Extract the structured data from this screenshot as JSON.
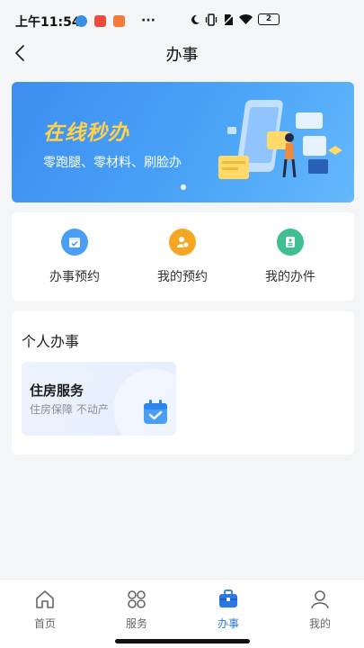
{
  "status_bar": {
    "time": "上午11:54",
    "battery": "2"
  },
  "nav": {
    "title": "办事",
    "back_icon": "chevron-left-icon"
  },
  "banner": {
    "headline": "在线秒办",
    "subtitle": "零跑腿、零材料、刷脸办"
  },
  "quick_actions": [
    {
      "label": "办事预约",
      "icon": "calendar-check-icon",
      "color": "#4a9ff5"
    },
    {
      "label": "我的预约",
      "icon": "user-clock-icon",
      "color": "#f5a623"
    },
    {
      "label": "我的办件",
      "icon": "document-icon",
      "color": "#3fbf8f"
    }
  ],
  "personal": {
    "title": "个人办事",
    "cards": [
      {
        "name": "住房服务",
        "desc": "住房保障 不动产",
        "icon": "calendar-check-icon"
      }
    ]
  },
  "tabs": [
    {
      "label": "首页",
      "icon": "home-icon",
      "active": false
    },
    {
      "label": "服务",
      "icon": "grid-icon",
      "active": false
    },
    {
      "label": "办事",
      "icon": "briefcase-icon",
      "active": true
    },
    {
      "label": "我的",
      "icon": "user-icon",
      "active": false
    }
  ],
  "colors": {
    "accent": "#2b78e4",
    "banner_headline": "#ffd24a"
  }
}
